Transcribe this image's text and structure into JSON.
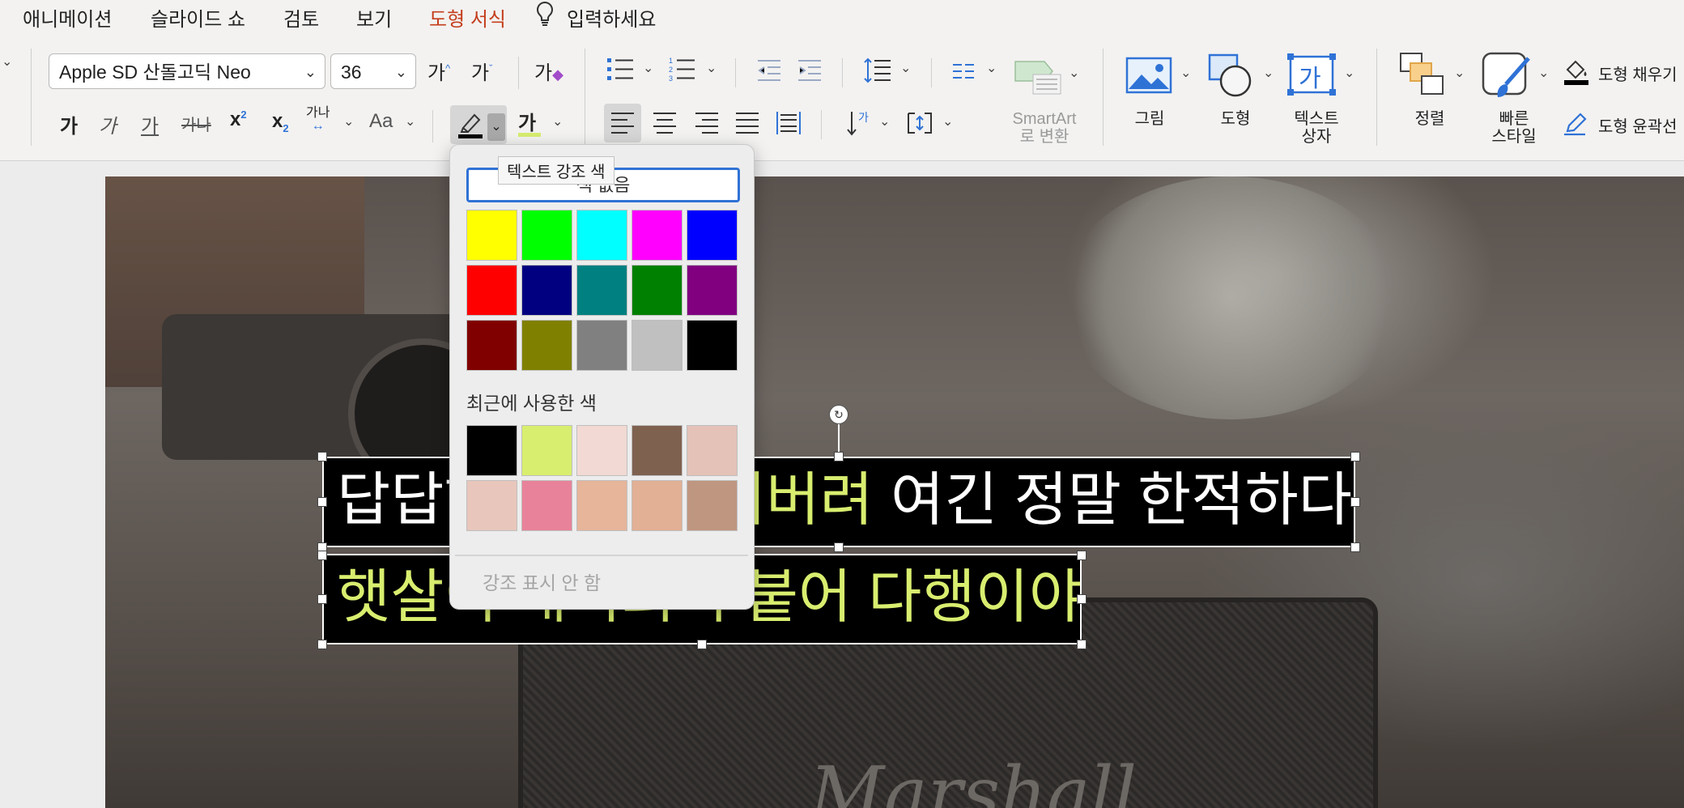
{
  "menu": {
    "tabs": [
      {
        "label": "애니메이션"
      },
      {
        "label": "슬라이드 쇼"
      },
      {
        "label": "검토"
      },
      {
        "label": "보기"
      },
      {
        "label": "도형 서식",
        "active": true
      }
    ],
    "tell_me": "입력하세요"
  },
  "ribbon": {
    "font_name": "Apple SD 산돌고딕 Neo",
    "font_size": "36",
    "grow_font": "가",
    "shrink_font": "가",
    "clear_format": "가",
    "bold": "가",
    "italic": "가",
    "underline": "가",
    "strike": "가Ч",
    "superscript": "x",
    "subscript": "x",
    "char_spacing": "가나",
    "change_case": "Aa",
    "font_color_glyph": "가",
    "smartart_label_line1": "SmartArt",
    "smartart_label_line2": "로 변환",
    "picture_label": "그림",
    "shape_label": "도형",
    "textbox_label_line1": "텍스트",
    "textbox_label_line2": "상자",
    "textbox_icon_glyph": "가",
    "arrange_label": "정렬",
    "quick_styles_line1": "빠른",
    "quick_styles_line2": "스타일",
    "shape_fill_label": "도형 채우기",
    "shape_outline_label": "도형 윤곽선",
    "highlight_color": "#000000",
    "font_color_bar": "#d6ec70"
  },
  "tooltip": "텍스트 강조 색",
  "highlight_popup": {
    "no_color_label": "색 없음",
    "standard_colors": [
      "#ffff00",
      "#00ff00",
      "#00ffff",
      "#ff00ff",
      "#0000ff",
      "#ff0000",
      "#000080",
      "#008080",
      "#008000",
      "#800080",
      "#800000",
      "#808000",
      "#808080",
      "#c0c0c0",
      "#000000"
    ],
    "recent_label": "최근에 사용한 색",
    "recent_colors": [
      "#000000",
      "#d8ee6f",
      "#f2d9d3",
      "#7f6150",
      "#e4c2b8",
      "#e8c6bc",
      "#e8829a",
      "#e6b59a",
      "#e2b094",
      "#bf9680"
    ],
    "no_highlight_label": "강조 표시 안 함"
  },
  "slide": {
    "line1_white_a": "답답하",
    "line1_yellow": "쳐버려",
    "line1_white_b": "여긴 정말 한적하다",
    "line2": "햇살이 내리쬐어 붙어 다행이야",
    "speaker_brand": "Marshall",
    "text_white": "#ffffff",
    "text_yellow": "#d8ee6f",
    "text_bg": "#000000"
  }
}
